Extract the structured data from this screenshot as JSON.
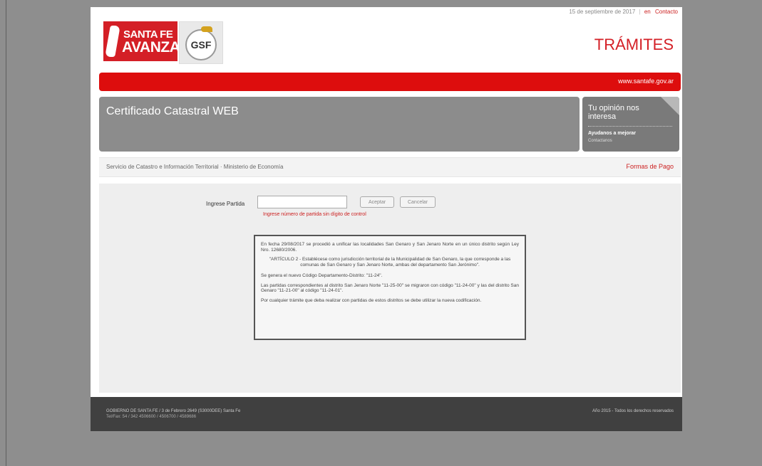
{
  "header": {
    "date": "15 de septiembre de 2017",
    "lang": "en",
    "contact": "Contacto",
    "brand_line1": "SANTA FE",
    "brand_line2": "AVANZA",
    "gsf_logo": "GSF",
    "section_title": "TRÁMITES",
    "site_url": "www.santafe.gov.ar"
  },
  "banner": {
    "title": "Certificado Catastral WEB"
  },
  "opinion": {
    "line1": "Tu opinión nos interesa",
    "line2": "Ayudanos a mejorar",
    "line3": "Contactanos"
  },
  "infobar": {
    "service": "Servicio de Catastro e Información Territorial · Ministerio de Economía",
    "payment_link": "Formas de Pago"
  },
  "form": {
    "label": "Ingrese Partida",
    "input_value": "",
    "input_placeholder": "",
    "accept_label": "Aceptar",
    "cancel_label": "Cancelar",
    "hint": "Ingrese número de partida sin dígito de control"
  },
  "notice": {
    "p1": "En fecha 29/08/2017 se procedió a unificar las localidades San Genaro y San Jenaro Norte en un único distrito según Ley Nro. 12680/2006.",
    "p2": "\"ARTÍCULO 2 - Establécese como jurisdicción territorial de la Municipalidad de San Genaro, la que corresponde a las comunas de San Genaro y San Jenaro Norte, ambas del departamento San Jerónimo\".",
    "p3": "Se genera el nuevo Código Departamento-Distrito: \"11-24\".",
    "p4": "Las partidas correspondientes al distrito San Jenaro Norte \"11-25-00\" se migraron con código \"11-24-00\" y las del distrito San Genaro \"11-21-00\" al código \"11-24-01\".",
    "p5": "Por cualquier trámite que deba realizar con partidas de estos distritos se debe utilizar la nueva codificación."
  },
  "footer": {
    "line1": "GOBIERNO DE SANTA FE / 3 de Febrero 2649 (S3000DEE) Santa Fe",
    "line2": "Tel/Fax: 54 / 342 4506600 / 4506700 / 4589686",
    "right": "Año 2015 - Todos los derechos reservados"
  },
  "colors": {
    "brand_red": "#d41f26",
    "bar_red": "#dd0d0d",
    "banner_gray": "#8c8c8c",
    "footer_dark": "#404040"
  }
}
